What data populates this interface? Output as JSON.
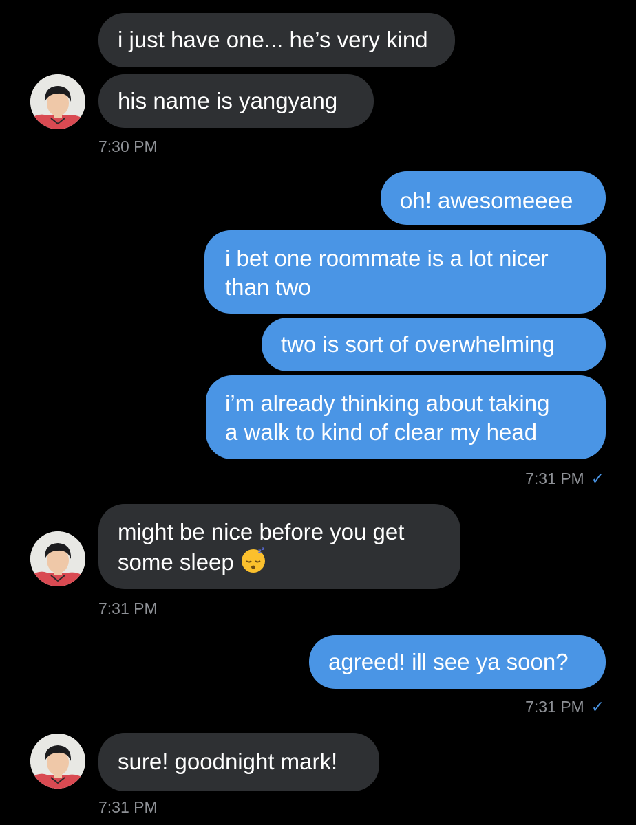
{
  "colors": {
    "background": "#000000",
    "incoming_bubble": "#2e3033",
    "outgoing_bubble": "#4a95e5",
    "timestamp": "#8e9196"
  },
  "messages": [
    {
      "direction": "incoming",
      "text": "i just have one... he’s very kind"
    },
    {
      "direction": "incoming",
      "text": "his name is yangyang"
    },
    {
      "direction": "outgoing",
      "text": "oh! awesomeeee"
    },
    {
      "direction": "outgoing",
      "line1": "i bet one roommate is a lot nicer",
      "line2": "than two"
    },
    {
      "direction": "outgoing",
      "text": "two is sort of overwhelming"
    },
    {
      "direction": "outgoing",
      "line1": "i’m already thinking about taking",
      "line2": "a walk to kind of clear my head"
    },
    {
      "direction": "incoming",
      "line1": "might be nice before you get",
      "line2": "some sleep",
      "emoji": "sleeping-face-emoji"
    },
    {
      "direction": "outgoing",
      "text": "agreed! ill see ya soon?"
    },
    {
      "direction": "incoming",
      "text": "sure! goodnight mark!"
    }
  ],
  "timestamps": {
    "t1": "7:30 PM",
    "t2": "7:31 PM",
    "t3": "7:31 PM",
    "t4": "7:31 PM",
    "t5": "7:31 PM"
  },
  "read_tick": "✓",
  "icons": {
    "read_receipt": "checkmark-icon",
    "avatar": "contact-avatar-photo"
  }
}
